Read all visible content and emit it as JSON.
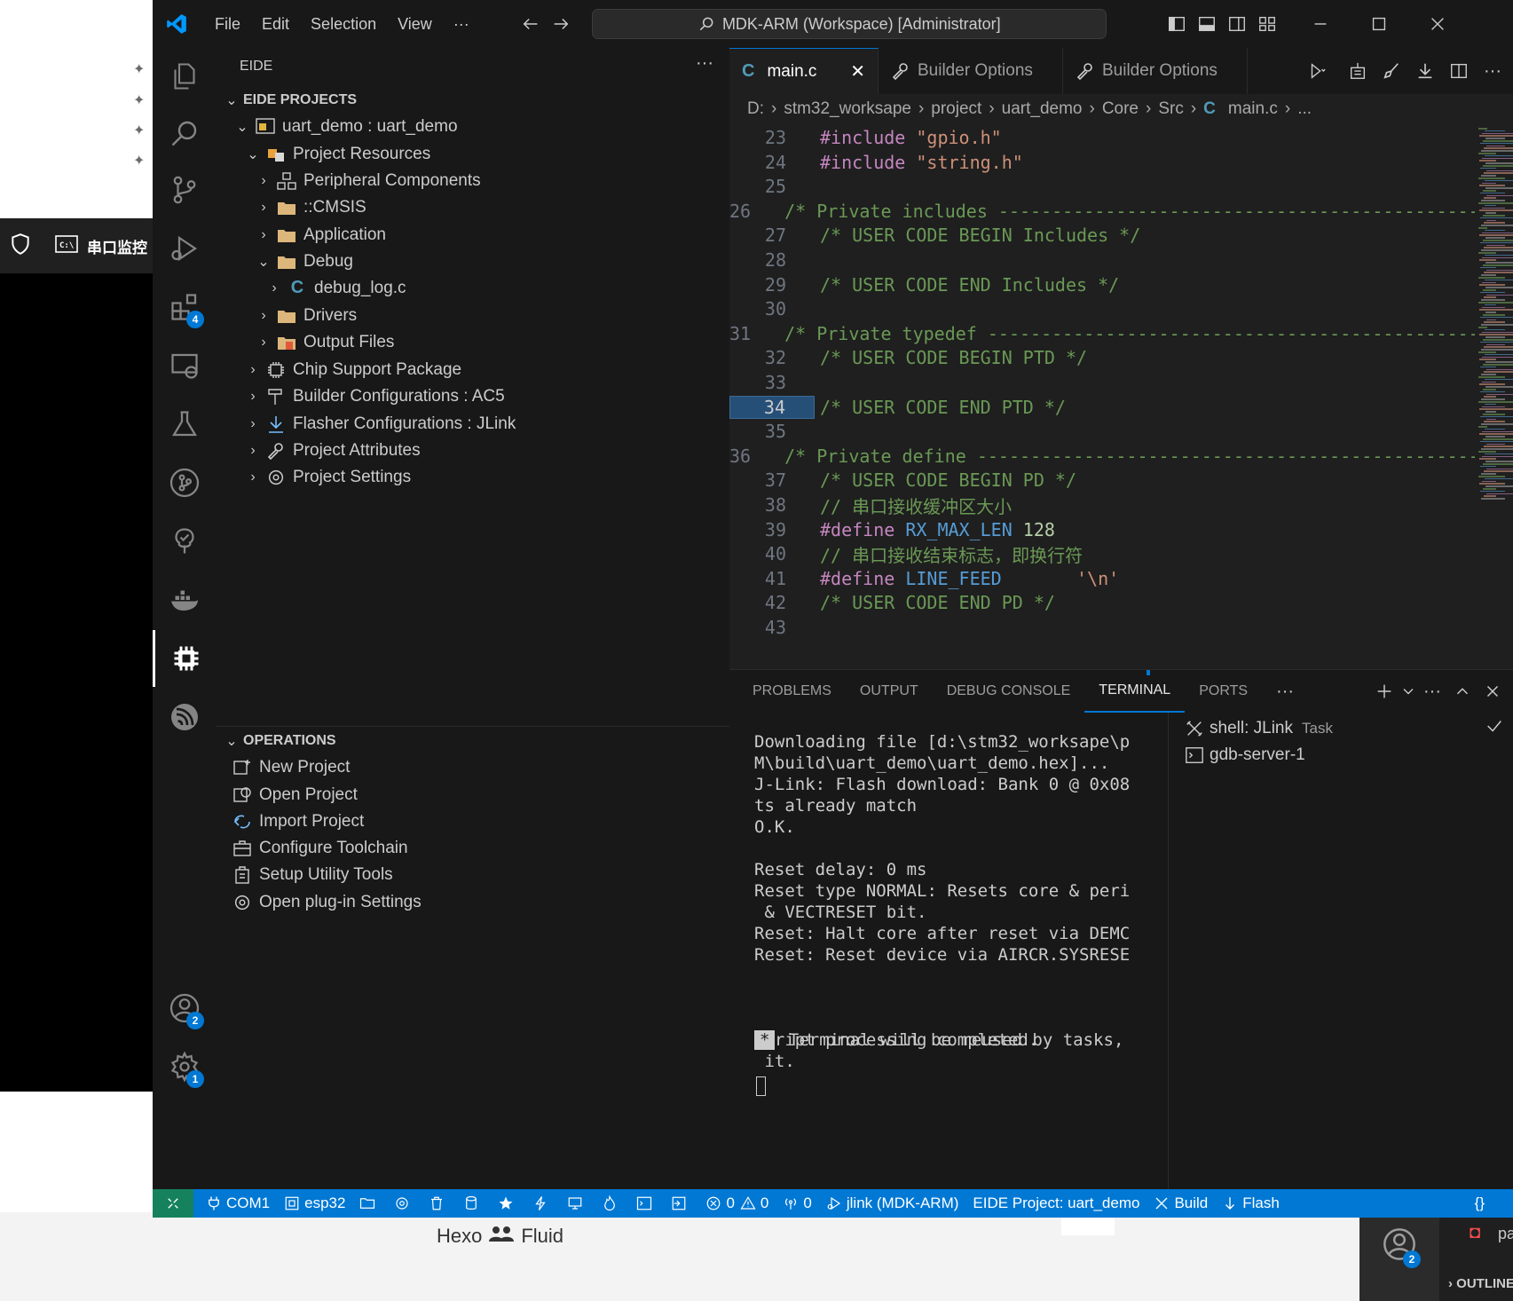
{
  "desktop": {
    "taskbar_label": "串口监控",
    "bottom_text": "Hexo",
    "bottom_text2": "Fluid",
    "bottom_right_outline": "OUTLINE",
    "bottom_right_pa": "pa",
    "bottom_right_badge": "2"
  },
  "titlebar": {
    "menu": [
      "File",
      "Edit",
      "Selection",
      "View",
      "···"
    ],
    "search": "MDK-ARM (Workspace) [Administrator]"
  },
  "activity": {
    "extensions_badge": "4",
    "accounts_badge": "2",
    "settings_badge": "1"
  },
  "sidebar": {
    "title": "EIDE",
    "more": "···",
    "projects_header": "EIDE PROJECTS",
    "tree": [
      {
        "label": "uart_demo : uart_demo"
      },
      {
        "label": "Project Resources"
      },
      {
        "label": "Peripheral Components"
      },
      {
        "label": "::CMSIS"
      },
      {
        "label": "Application"
      },
      {
        "label": "Debug"
      },
      {
        "label": "debug_log.c"
      },
      {
        "label": "Drivers"
      },
      {
        "label": "Output Files"
      },
      {
        "label": "Chip Support Package"
      },
      {
        "label": "Builder Configurations : AC5"
      },
      {
        "label": "Flasher Configurations : JLink"
      },
      {
        "label": "Project Attributes"
      },
      {
        "label": "Project Settings"
      }
    ],
    "operations_header": "OPERATIONS",
    "operations": [
      {
        "label": "New Project"
      },
      {
        "label": "Open Project"
      },
      {
        "label": "Import Project"
      },
      {
        "label": "Configure Toolchain"
      },
      {
        "label": "Setup Utility Tools"
      },
      {
        "label": "Open plug-in Settings"
      }
    ]
  },
  "editor": {
    "tabs": [
      {
        "label": "main.c",
        "active": true
      },
      {
        "label": "Builder Options"
      },
      {
        "label": "Builder Options"
      }
    ],
    "breadcrumb": [
      "D:",
      "stm32_worksape",
      "project",
      "uart_demo",
      "Core",
      "Src",
      "main.c",
      "..."
    ],
    "lines": [
      {
        "n": "23",
        "parts": [
          [
            "kw",
            "#include "
          ],
          [
            "str",
            "\"gpio.h\""
          ]
        ]
      },
      {
        "n": "24",
        "parts": [
          [
            "kw",
            "#include "
          ],
          [
            "str",
            "\"string.h\""
          ]
        ]
      },
      {
        "n": "25",
        "parts": []
      },
      {
        "n": "26",
        "parts": [
          [
            "com",
            "/* Private includes -----------------------------------------------"
          ]
        ]
      },
      {
        "n": "27",
        "parts": [
          [
            "com",
            "/* USER CODE BEGIN Includes */"
          ]
        ]
      },
      {
        "n": "28",
        "parts": []
      },
      {
        "n": "29",
        "parts": [
          [
            "com",
            "/* USER CODE END Includes */"
          ]
        ]
      },
      {
        "n": "30",
        "parts": []
      },
      {
        "n": "31",
        "parts": [
          [
            "com",
            "/* Private typedef ------------------------------------------------"
          ]
        ]
      },
      {
        "n": "32",
        "parts": [
          [
            "com",
            "/* USER CODE BEGIN PTD */"
          ]
        ]
      },
      {
        "n": "33",
        "parts": []
      },
      {
        "n": "34",
        "parts": [
          [
            "com",
            "/* USER CODE END PTD */"
          ]
        ]
      },
      {
        "n": "35",
        "parts": []
      },
      {
        "n": "36",
        "parts": [
          [
            "com",
            "/* Private define -------------------------------------------------"
          ]
        ]
      },
      {
        "n": "37",
        "parts": [
          [
            "com",
            "/* USER CODE BEGIN PD */"
          ]
        ]
      },
      {
        "n": "38",
        "parts": [
          [
            "com",
            "// 串口接收缓冲区大小"
          ]
        ]
      },
      {
        "n": "39",
        "parts": [
          [
            "kw",
            "#define "
          ],
          [
            "mac",
            "RX_MAX_LEN "
          ],
          [
            "num",
            "128"
          ]
        ]
      },
      {
        "n": "40",
        "parts": [
          [
            "com",
            "// 串口接收结束标志，即换行符"
          ]
        ]
      },
      {
        "n": "41",
        "parts": [
          [
            "kw",
            "#define "
          ],
          [
            "mac",
            "LINE_FEED       "
          ],
          [
            "str",
            "'\\n'"
          ]
        ]
      },
      {
        "n": "42",
        "parts": [
          [
            "com",
            "/* USER CODE END PD */"
          ]
        ]
      },
      {
        "n": "43",
        "parts": []
      }
    ],
    "current_line": "34"
  },
  "panel": {
    "tabs": [
      "PROBLEMS",
      "OUTPUT",
      "DEBUG CONSOLE",
      "TERMINAL",
      "PORTS",
      "···"
    ],
    "active_tab": "TERMINAL",
    "terminal_lines": [
      "Downloading file [d:\\stm32_worksape\\p",
      "M\\build\\uart_demo\\uart_demo.hex]...",
      "J-Link: Flash download: Bank 0 @ 0x08",
      "ts already match",
      "O.K.",
      "",
      "Reset delay: 0 ms",
      "Reset type NORMAL: Resets core & peri",
      " & VECTRESET bit.",
      "Reset: Halt core after reset via DEMC",
      "Reset: Reset device via AIRCR.SYSRESE",
      "",
      "",
      "",
      "Script processing completed."
    ],
    "terminal_tail": " Terminal will be reused by tasks,",
    "terminal_tail2": " it.",
    "terminal_star": "*",
    "terminals": [
      {
        "label": "shell: JLink",
        "tag": "Task"
      },
      {
        "label": "gdb-server-1",
        "tag": ""
      }
    ]
  },
  "statusbar": {
    "com": "COM1",
    "board": "esp32",
    "errors": "0",
    "warnings": "0",
    "ports": "0",
    "debugger": "jlink (MDK-ARM)",
    "project": "EIDE Project: uart_demo",
    "build": "Build",
    "flash": "Flash",
    "braces": "{}"
  },
  "colors": {
    "accent": "#0078d4",
    "comment": "#6a9955",
    "keyword": "#c586c0",
    "string": "#ce9178"
  }
}
